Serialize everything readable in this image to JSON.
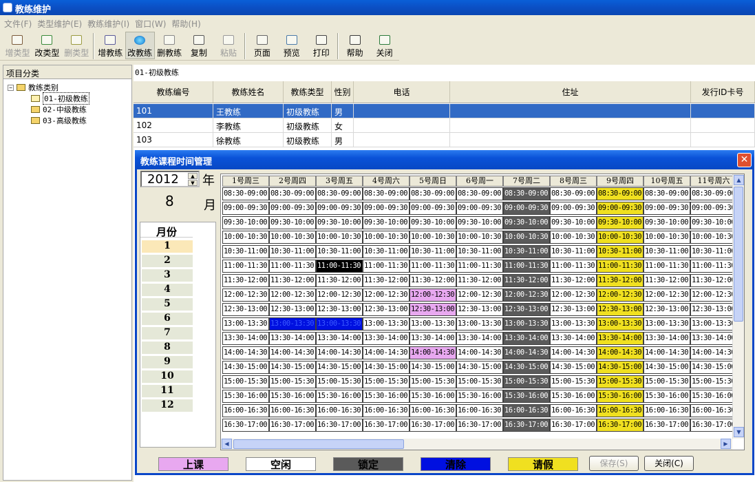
{
  "window": {
    "title": "教练维护"
  },
  "menu": [
    "文件(F)",
    "类型维护(E)",
    "教练维护(I)",
    "窗口(W)",
    "帮助(H)"
  ],
  "toolbar": [
    {
      "label": "增类型",
      "enabled": false,
      "icon": "add-type-icon"
    },
    {
      "label": "改类型",
      "enabled": true,
      "icon": "edit-type-icon"
    },
    {
      "label": "删类型",
      "enabled": false,
      "icon": "delete-type-icon"
    },
    {
      "label": "增教练",
      "enabled": true,
      "icon": "add-coach-icon"
    },
    {
      "label": "改教练",
      "enabled": true,
      "active": true,
      "icon": "edit-coach-icon"
    },
    {
      "label": "删教练",
      "enabled": true,
      "icon": "eraser-icon"
    },
    {
      "label": "复制",
      "enabled": true,
      "icon": "copy-icon"
    },
    {
      "label": "粘贴",
      "enabled": false,
      "icon": "paste-icon"
    },
    {
      "label": "页面",
      "enabled": true,
      "icon": "page-setup-icon"
    },
    {
      "label": "预览",
      "enabled": true,
      "icon": "preview-icon"
    },
    {
      "label": "打印",
      "enabled": true,
      "icon": "printer-icon"
    },
    {
      "label": "帮助",
      "enabled": true,
      "icon": "help-icon"
    },
    {
      "label": "关闭",
      "enabled": true,
      "icon": "exit-door-icon"
    }
  ],
  "tree": {
    "header": "项目分类",
    "root": "教练类别",
    "items": [
      "01-初级教练",
      "02-中级教练",
      "03-高级教练"
    ],
    "selected": 0
  },
  "breadcrumb": "01-初级教练",
  "grid": {
    "columns": [
      "教练编号",
      "教练姓名",
      "教练类型",
      "性别",
      "电话",
      "住址",
      "发行ID卡号"
    ],
    "rows": [
      [
        "101",
        "王教练",
        "初级教练",
        "男",
        "",
        "",
        ""
      ],
      [
        "102",
        "李教练",
        "初级教练",
        "女",
        "",
        "",
        ""
      ],
      [
        "103",
        "徐教练",
        "初级教练",
        "男",
        "",
        "",
        ""
      ]
    ],
    "selected_row": 0
  },
  "dialog": {
    "title": "教练课程时间管理",
    "year": "2012",
    "year_label": "年",
    "month": "8",
    "month_label": "月",
    "months_header": "月份",
    "months": [
      "1",
      "2",
      "3",
      "4",
      "5",
      "6",
      "7",
      "8",
      "9",
      "10",
      "11",
      "12"
    ],
    "selected_month": 0,
    "days": [
      "1号周三",
      "2号周四",
      "3号周五",
      "4号周六",
      "5号周日",
      "6号周一",
      "7号周二",
      "8号周三",
      "9号周四",
      "10号周五",
      "11号周六"
    ],
    "slots": [
      "08:30-09:00",
      "09:00-09:30",
      "09:30-10:00",
      "10:00-10:30",
      "10:30-11:00",
      "11:00-11:30",
      "11:30-12:00",
      "12:00-12:30",
      "12:30-13:00",
      "13:00-13:30",
      "13:30-14:00",
      "14:00-14:30",
      "14:30-15:00",
      "15:00-15:30",
      "15:30-16:00",
      "16:00-16:30",
      "16:30-17:00"
    ],
    "status_colors": {
      "free": "#ffffff",
      "class": "#e8a8f0",
      "locked": "#5a5a5a",
      "clear": "#0010e0",
      "leave": "#f0e020",
      "black": "#000000"
    },
    "cells": [
      {
        "day": 6,
        "all": true,
        "status": "locked"
      },
      {
        "day": 8,
        "all": true,
        "status": "leave"
      },
      {
        "day": 2,
        "slot": 5,
        "status": "black"
      },
      {
        "day": 4,
        "slot": 7,
        "status": "class"
      },
      {
        "day": 4,
        "slot": 8,
        "status": "class"
      },
      {
        "day": 4,
        "slot": 11,
        "status": "class"
      },
      {
        "day": 1,
        "slot": 9,
        "status": "clear"
      },
      {
        "day": 2,
        "slot": 9,
        "status": "clear"
      }
    ],
    "legend": [
      {
        "label": "上课",
        "color": "#e8a8f0"
      },
      {
        "label": "空闲",
        "color": "#ffffff"
      },
      {
        "label": "锁定",
        "color": "#5a5a5a"
      },
      {
        "label": "清除",
        "color": "#0010e0"
      },
      {
        "label": "请假",
        "color": "#f0e020"
      }
    ],
    "save_label": "保存(S)",
    "close_label": "关闭(C)"
  }
}
